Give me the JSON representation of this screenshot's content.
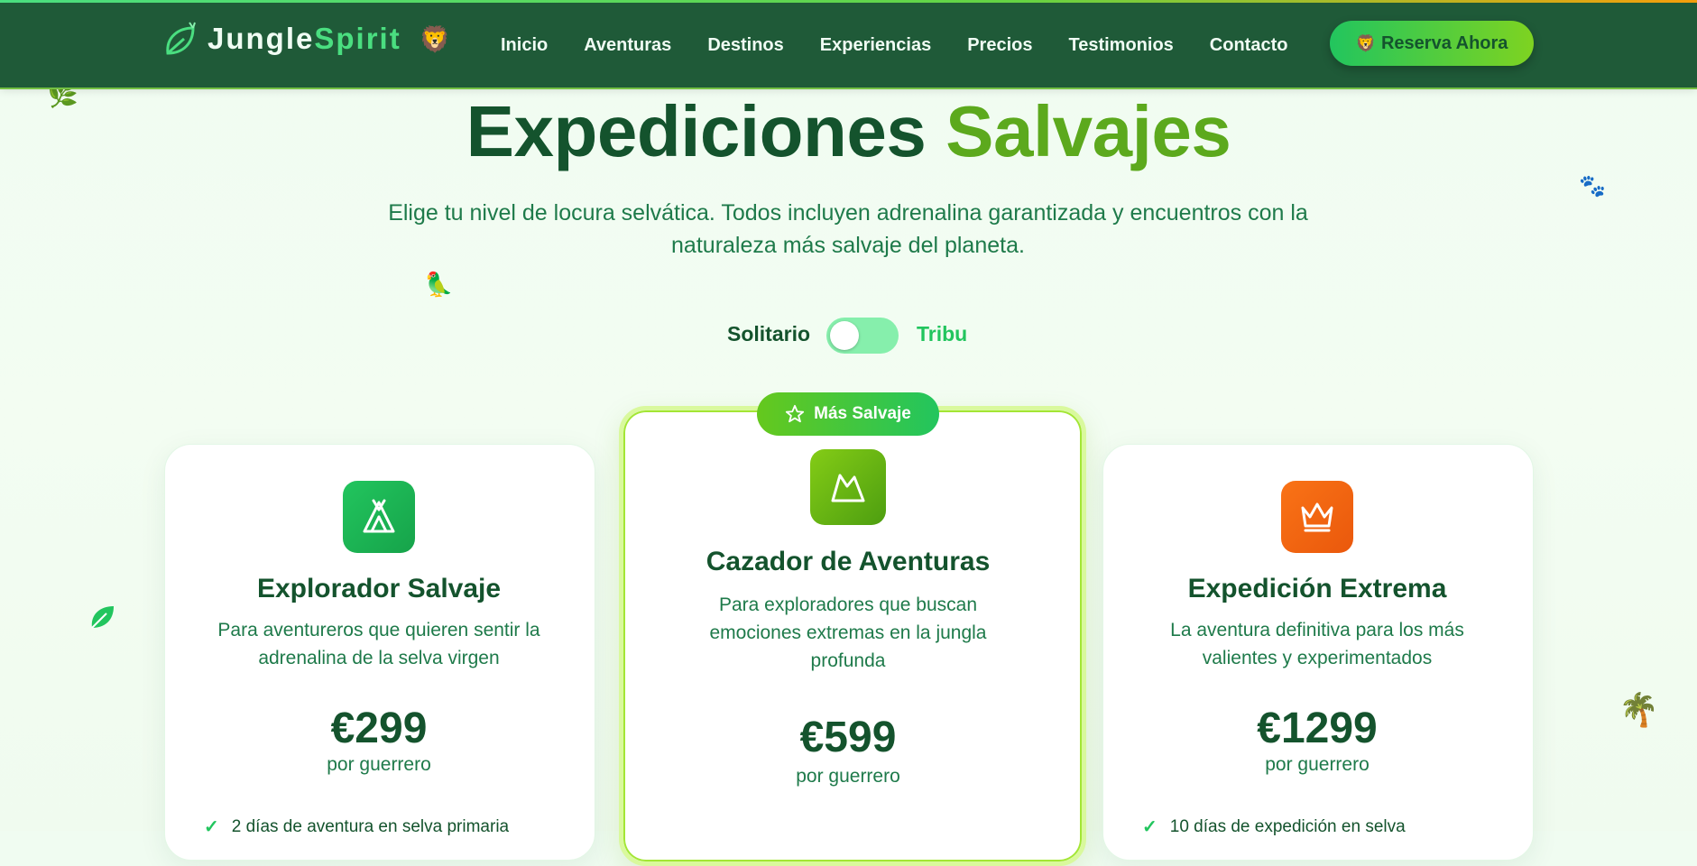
{
  "brand": {
    "name_primary": "Jungle",
    "name_accent": "Spirit",
    "lion_emoji": "🦁"
  },
  "nav": {
    "items": [
      "Inicio",
      "Aventuras",
      "Destinos",
      "Experiencias",
      "Precios",
      "Testimonios",
      "Contacto"
    ],
    "cta_emoji": "🦁",
    "cta_label": "Reserva Ahora"
  },
  "hero": {
    "title_main": "Expediciones",
    "title_accent": "Salvajes",
    "subtitle": "Elige tu nivel de locura selvática. Todos incluyen adrenalina garantizada y encuentros con la naturaleza más salvaje del planeta."
  },
  "billing_toggle": {
    "left_label": "Solitario",
    "right_label": "Tribu",
    "state": "Solitario"
  },
  "plans": [
    {
      "icon": "tent-icon",
      "title": "Explorador Salvaje",
      "description": "Para aventureros que quieren sentir la adrenalina de la selva virgen",
      "price": "€299",
      "unit": "por guerrero",
      "first_feature": "2 días de aventura en selva primaria"
    },
    {
      "icon": "mountain-icon",
      "badge": "Más Salvaje",
      "title": "Cazador de Aventuras",
      "description": "Para exploradores que buscan emociones extremas en la jungla profunda",
      "price": "€599",
      "unit": "por guerrero"
    },
    {
      "icon": "crown-icon",
      "title": "Expedición Extrema",
      "description": "La aventura definitiva para los más valientes y experimentados",
      "price": "€1299",
      "unit": "por guerrero",
      "first_feature": "10 días de expedición en selva"
    }
  ],
  "decorations": {
    "parrot": "🦜",
    "paws": "🐾",
    "butterfly": "🦋",
    "palm": "🌴",
    "herb": "🌿"
  },
  "colors": {
    "navbar": "#1f5a38",
    "accent_green": "#22c55e",
    "lime": "#84cc16",
    "orange": "#f97316",
    "text_dark": "#14532d"
  }
}
